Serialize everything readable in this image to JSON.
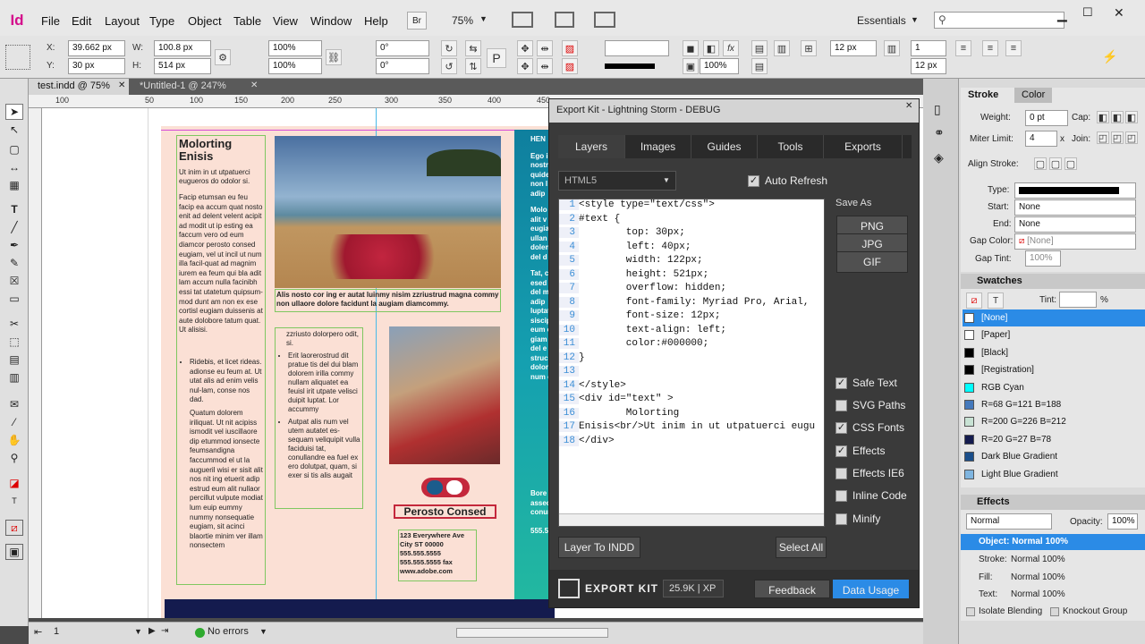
{
  "app": {
    "logo": "Id",
    "bridge": "Br",
    "zoom": "75%",
    "workspace": "Essentials"
  },
  "menu": [
    "File",
    "Edit",
    "Layout",
    "Type",
    "Object",
    "Table",
    "View",
    "Window",
    "Help"
  ],
  "control": {
    "x": "39.662 px",
    "y": "30 px",
    "w": "100.8 px",
    "h": "514 px",
    "scale_w": "100%",
    "scale_h": "100%",
    "rotate": "0°",
    "shear": "0°",
    "stroke_weight": "",
    "opacity": "100%",
    "gutter": "12 px",
    "cols": "1",
    "col_gap": "12 px",
    "x_label": "X:",
    "y_label": "Y:",
    "w_label": "W:",
    "h_label": "H:"
  },
  "tabs": [
    "test.indd @ 75%",
    "*Untitled-1 @ 247%"
  ],
  "ruler": [
    "100",
    "50",
    "100",
    "150",
    "200",
    "250",
    "300",
    "350",
    "400",
    "450",
    "500",
    "550",
    "600",
    "650",
    "700",
    "750"
  ],
  "document": {
    "heading": "Molorting\nEnisis",
    "intro": "Ut inim in ut utpatuerci eugueros do odolor si.",
    "body": "Facip etumsan eu feu facip ea accum quat nosto enit ad delent velent acipit ad modit ut ip esting ea faccum vero od eum diamcor perosto consed eugiam, vel ut incil ut num illa facil-quat ad magnim iurem ea feum qui bla adit lam accum nulla facinibh essi tat utatetum quipsum-mod dunt am non ex ese cortisl eugiam duissenis at aute dolobore tatum quat. Ut alisisi.",
    "bullets1": [
      "Ridebis, et licet rideas. adionse eu feum at. Ut utat alis ad enim velis nul-lam, conse nos dad.",
      "Quatum dolorem iriliquat. Ut nit acipiss ismodit vel iuscillaore dip etummod ionsecte feumsandigna faccummod el ut la augueril wisi er sisit alit nos nit ing etuerit adip estrud eum alit nullaor percillut vulpute modiat lum euip eummy nummy nonsequatie eugiam, sit acinci blaortie minim ver illam nonsectem"
    ],
    "caption": "Alis nosto cor ing er autat luinmy nisim zzriustrud magna commy non ullaore dolore facidunt la augiam diamcommy.",
    "mid_intro": "zzriusto dolorpero odit, si.",
    "bullets2": [
      "Erit laorerostrud dit pratue tis del dui blam dolorem irilla commy nullam aliquatet ea feuisl irit utpate velisci duipit luptat. Lor accummy",
      "Autpat alis num vel utem autatet es-sequam veliquipit vulla faciduisi tat, conullandre ea fuel ex ero dolutpat, quam, si exer si tis alis augait"
    ],
    "logo_name": "Perosto Consed",
    "address": [
      "123 Everywhere Ave",
      "City ST 00000",
      "555.555.5555",
      "555.555.5555 fax",
      "www.adobe.com"
    ],
    "right_col": [
      "HEN",
      "Ego i",
      "nostr",
      "quide",
      "non l",
      "adip",
      "Molo",
      "alit v",
      "eugia",
      "ullan",
      "dolen",
      "del d",
      "Tat, c",
      "esed",
      "del m",
      "adip",
      "luptat",
      "siscip",
      "eum e",
      "giam",
      "del e",
      "struc",
      "dolor",
      "num o"
    ],
    "right_blurb": [
      "Bore v",
      "assect",
      "conun",
      "555.55"
    ]
  },
  "exportkit": {
    "title": "Export Kit - Lightning Storm - DEBUG",
    "tabs": [
      "Layers",
      "Images",
      "Guides",
      "Tools",
      "Exports"
    ],
    "format": "HTML5",
    "auto_refresh": "Auto Refresh",
    "save_as": "Save As",
    "save_buttons": [
      "PNG",
      "JPG",
      "GIF"
    ],
    "code": [
      [
        "1",
        "<style type=\"text/css\">"
      ],
      [
        "2",
        "#text {"
      ],
      [
        "3",
        "        top: 30px;"
      ],
      [
        "4",
        "        left: 40px;"
      ],
      [
        "5",
        "        width: 122px;"
      ],
      [
        "6",
        "        height: 521px;"
      ],
      [
        "7",
        "        overflow: hidden;"
      ],
      [
        "8",
        "        font-family: Myriad Pro, Arial,"
      ],
      [
        "9",
        "        font-size: 12px;"
      ],
      [
        "10",
        "        text-align: left;"
      ],
      [
        "11",
        "        color:#000000;"
      ],
      [
        "12",
        "}"
      ],
      [
        "13",
        ""
      ],
      [
        "14",
        "</style>"
      ],
      [
        "15",
        "<div id=\"text\" >"
      ],
      [
        "16",
        "        Molorting"
      ],
      [
        "17",
        "Enisis<br/>Ut inim in ut utpatuerci eugu"
      ],
      [
        "18",
        "</div>"
      ]
    ],
    "options": [
      {
        "label": "Safe Text",
        "checked": true
      },
      {
        "label": "SVG Paths",
        "checked": false
      },
      {
        "label": "CSS Fonts",
        "checked": true
      },
      {
        "label": "Effects",
        "checked": true
      },
      {
        "label": "Effects IE6",
        "checked": false
      },
      {
        "label": "Inline Code",
        "checked": false
      },
      {
        "label": "Minify",
        "checked": false
      }
    ],
    "layer_to_indd": "Layer To INDD",
    "select_all": "Select All",
    "brand": "EXPORT KIT",
    "xp": "25.9K | XP",
    "feedback": "Feedback",
    "data_usage": "Data Usage"
  },
  "stroke_panel": {
    "tab1": "Stroke",
    "tab2": "Color",
    "weight_label": "Weight:",
    "weight": "0 pt",
    "cap_label": "Cap:",
    "miter_label": "Miter Limit:",
    "miter": "4",
    "miter_x": "x",
    "join_label": "Join:",
    "align_label": "Align Stroke:",
    "type_label": "Type:",
    "start_label": "Start:",
    "start": "None",
    "end_label": "End:",
    "end": "None",
    "gap_label": "Gap Color:",
    "gap": "[None]",
    "gap_tint_label": "Gap Tint:",
    "gap_tint": "100%"
  },
  "swatches": {
    "title": "Swatches",
    "tint_label": "Tint:",
    "tint_unit": "%",
    "items": [
      {
        "name": "[None]",
        "color": "#ffffff"
      },
      {
        "name": "[Paper]",
        "color": "#ffffff"
      },
      {
        "name": "[Black]",
        "color": "#000000"
      },
      {
        "name": "[Registration]",
        "color": "#000000"
      },
      {
        "name": "RGB Cyan",
        "color": "#00ffff"
      },
      {
        "name": "R=68 G=121 B=188",
        "color": "#4479bc"
      },
      {
        "name": "R=200 G=226 B=212",
        "color": "#c8e2d4"
      },
      {
        "name": "R=20 G=27 B=78",
        "color": "#141b4e"
      },
      {
        "name": "Dark Blue Gradient",
        "color": "#1a4e8a"
      },
      {
        "name": "Light Blue Gradient",
        "color": "#7fb5e0"
      }
    ]
  },
  "effects": {
    "title": "Effects",
    "mode": "Normal",
    "opacity_label": "Opacity:",
    "opacity": "100%",
    "object": "Object: Normal 100%",
    "stroke": "Stroke:",
    "stroke_val": "Normal 100%",
    "fill": "Fill:",
    "fill_val": "Normal 100%",
    "text": "Text:",
    "text_val": "Normal 100%",
    "isolate": "Isolate Blending",
    "knockout": "Knockout Group"
  },
  "status": {
    "page": "1",
    "errors": "No errors"
  }
}
